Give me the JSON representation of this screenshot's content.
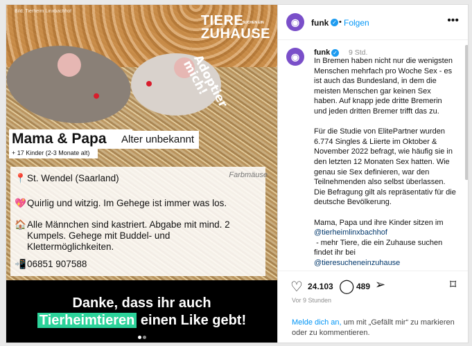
{
  "media": {
    "credit": "Bild: Tierheim Linxbachhof",
    "brand_line1": "TIERE",
    "brand_small": "SUCHEN EIN",
    "brand_line2": "ZUHAUSE",
    "adopt_text": "Adoptier\nmich!",
    "name": "Mama & Papa",
    "age": "Alter unbekannt",
    "kids": "+ 17 Kinder (2-3 Monate alt)",
    "location": "St. Wendel (Saarland)",
    "breed": "Farbmäuse",
    "trait": "Quirlig und witzig. Im Gehege ist immer was los.",
    "home_line1": "Alle Männchen sind kastriert. Abgabe mit mind. 2",
    "home_line2": "Kumpels. Gehege mit Buddel- und",
    "home_line3": "Klettermöglichkeiten.",
    "phone": "06851 907588",
    "thanks_line1": "Danke, dass ihr auch",
    "thanks_highlight": "Tierheimtieren",
    "thanks_rest": " einen Like gebt!"
  },
  "header": {
    "username": "funk",
    "verified_icon": "✓",
    "separator": "•",
    "follow": "Folgen",
    "more_icon": "•••"
  },
  "caption": {
    "username": "funk",
    "time": "9 Std.",
    "para1": "In Bremen haben nicht nur die wenigsten Menschen mehrfach pro Woche Sex - es ist auch das Bundesland, in dem die meisten Menschen gar keinen Sex haben. Auf knapp jede dritte Bremerin und jeden dritten Bremer trifft das zu.",
    "para2": "Für die Studie von ElitePartner wurden 6.774 Singles & Liierte im Oktober & November 2022 befragt, wie häufig sie in den letzten 12 Monaten Sex hatten. Wie genau sie Sex definieren, war den Teilnehmenden also selbst überlassen. Die Befragung gilt als repräsentativ für die deutsche Bevölkerung.",
    "para3": "Mama, Papa und ihre Kinder sitzen im",
    "link1": "@tierheimlinxbachhof",
    "para3b": " - mehr Tiere, die ein Zuhause suchen findet ihr bei",
    "link2": "@tieresucheneinzuhause",
    "trail": "-"
  },
  "actions": {
    "likes": "24.103",
    "comments": "489",
    "posted": "Vor 9 Stunden"
  },
  "login": {
    "link": "Melde dich an,",
    "rest": " um mit „Gefällt mir“ zu markieren oder zu kommentieren."
  },
  "colors": {
    "accent": "#0095f6",
    "highlight": "#2cd39a",
    "brand_avatar": "#7a4fc9"
  }
}
